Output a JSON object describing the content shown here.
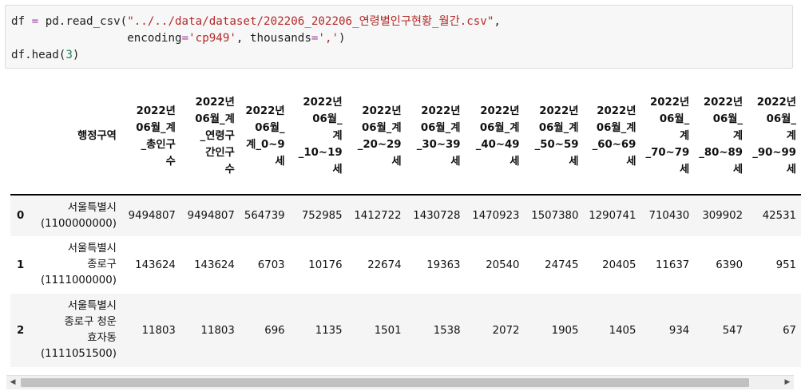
{
  "code": {
    "line1_a": "df ",
    "line1_op": "=",
    "line1_b": " pd.read_csv(",
    "line1_str": "\"../../data/dataset/202206_202206_연령별인구현황_월간.csv\"",
    "line1_c": ",",
    "line2_indent": "                 ",
    "line2_a": "encoding",
    "line2_op": "=",
    "line2_str": "'cp949'",
    "line2_b": ", thousands",
    "line2_op2": "=",
    "line2_str2": "','",
    "line2_c": ")",
    "line3_a": "df.head(",
    "line3_num": "3",
    "line3_b": ")"
  },
  "table": {
    "index_header": "행정구역",
    "columns": [
      [
        "2022년",
        "06월_계",
        "_총인구",
        "수"
      ],
      [
        "2022년",
        "06월_계",
        "_연령구",
        "간인구",
        "수"
      ],
      [
        "2022년",
        "06월_",
        "계_0~9",
        "세"
      ],
      [
        "2022년",
        "06월_",
        "계",
        "_10~19",
        "세"
      ],
      [
        "2022년",
        "06월_계",
        "_20~29",
        "세"
      ],
      [
        "2022년",
        "06월_계",
        "_30~39",
        "세"
      ],
      [
        "2022년",
        "06월_계",
        "_40~49",
        "세"
      ],
      [
        "2022년",
        "06월_계",
        "_50~59",
        "세"
      ],
      [
        "2022년",
        "06월_계",
        "_60~69",
        "세"
      ],
      [
        "2022년",
        "06월_",
        "계",
        "_70~79",
        "세"
      ],
      [
        "2022년",
        "06월_",
        "계",
        "_80~89",
        "세"
      ],
      [
        "2022년",
        "06월_",
        "계",
        "_90~99",
        "세"
      ]
    ],
    "rows": [
      {
        "index": "0",
        "name_lines": [
          "서울특별시",
          "(1100000000)"
        ],
        "values": [
          "9494807",
          "9494807",
          "564739",
          "752985",
          "1412722",
          "1430728",
          "1470923",
          "1507380",
          "1290741",
          "710430",
          "309902",
          "42531"
        ]
      },
      {
        "index": "1",
        "name_lines": [
          "서울특별시",
          "종로구",
          "(1111000000)"
        ],
        "values": [
          "143624",
          "143624",
          "6703",
          "10176",
          "22674",
          "19363",
          "20540",
          "24745",
          "20405",
          "11637",
          "6390",
          "951"
        ]
      },
      {
        "index": "2",
        "name_lines": [
          "서울특별시",
          "종로구 청운",
          "효자동",
          "(1111051500)"
        ],
        "values": [
          "11803",
          "11803",
          "696",
          "1135",
          "1501",
          "1538",
          "2072",
          "1905",
          "1405",
          "934",
          "547",
          "67"
        ]
      }
    ]
  },
  "scrollbar": {
    "left_arrow": "◀",
    "right_arrow": "▶"
  }
}
